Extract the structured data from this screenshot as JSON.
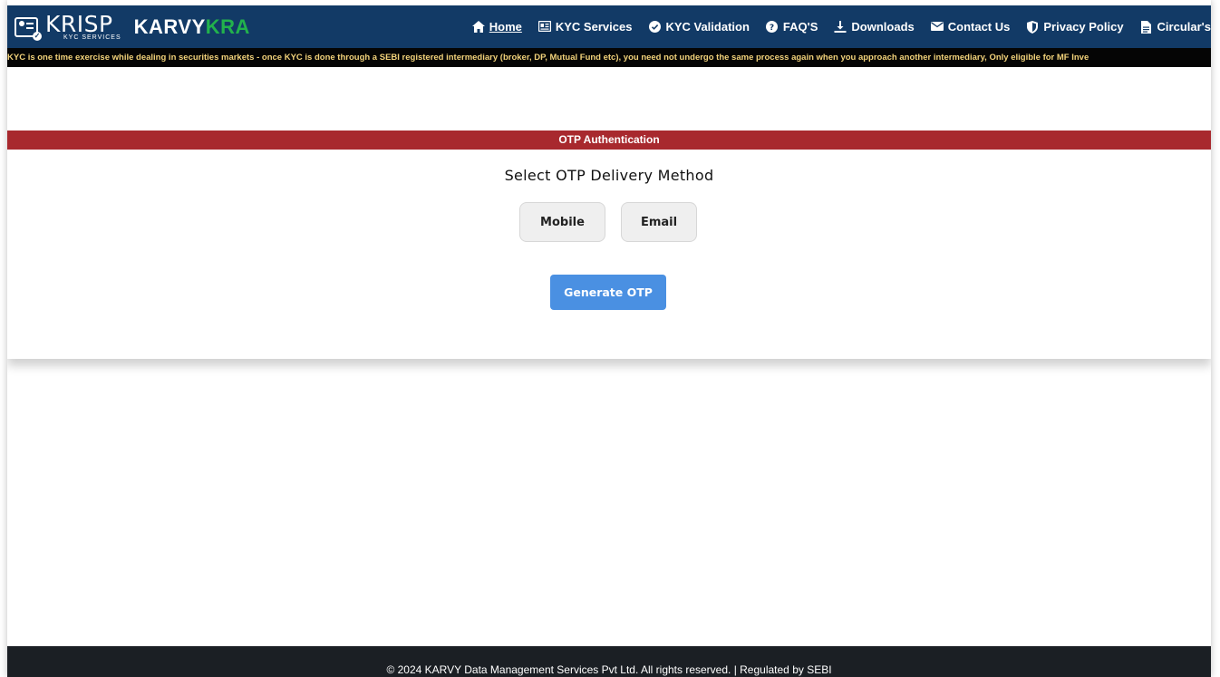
{
  "header": {
    "brand": {
      "krisp": "KRISP",
      "krisp_sub": "KYC SERVICES",
      "karvy_part1": "KARVY",
      "karvy_part2": "KRA"
    },
    "nav": [
      {
        "label": "Home",
        "icon": "home-icon",
        "active": true
      },
      {
        "label": "KYC Services",
        "icon": "id-card-icon",
        "active": false
      },
      {
        "label": "KYC Validation",
        "icon": "check-circle-icon",
        "active": false
      },
      {
        "label": "FAQ'S",
        "icon": "question-circle-icon",
        "active": false
      },
      {
        "label": "Downloads",
        "icon": "download-icon",
        "active": false
      },
      {
        "label": "Contact Us",
        "icon": "envelope-icon",
        "active": false
      },
      {
        "label": "Privacy Policy",
        "icon": "shield-icon",
        "active": false
      },
      {
        "label": "Circular's",
        "icon": "file-icon",
        "active": false
      }
    ]
  },
  "ticker": {
    "text": "KYC is one time exercise while dealing in securities markets - once KYC is done through a SEBI registered intermediary (broker, DP, Mutual Fund etc), you need not undergo the same process again when you approach another intermediary, Only eligible for MF Inve"
  },
  "otp": {
    "bar_title": "OTP Authentication",
    "select_title": "Select OTP Delivery Method",
    "mobile_label": "Mobile",
    "email_label": "Email",
    "generate_label": "Generate OTP"
  },
  "footer": {
    "text": "© 2024 KARVY Data Management Services Pvt Ltd. All rights reserved. | Regulated by SEBI"
  },
  "colors": {
    "header_bg": "#123a66",
    "kra_green": "#22b24c",
    "ticker_bg": "#050505",
    "ticker_text": "#f2d27a",
    "otp_bar": "#a8292e",
    "generate_button": "#4a90e2",
    "footer_bg": "#1b1f24"
  }
}
